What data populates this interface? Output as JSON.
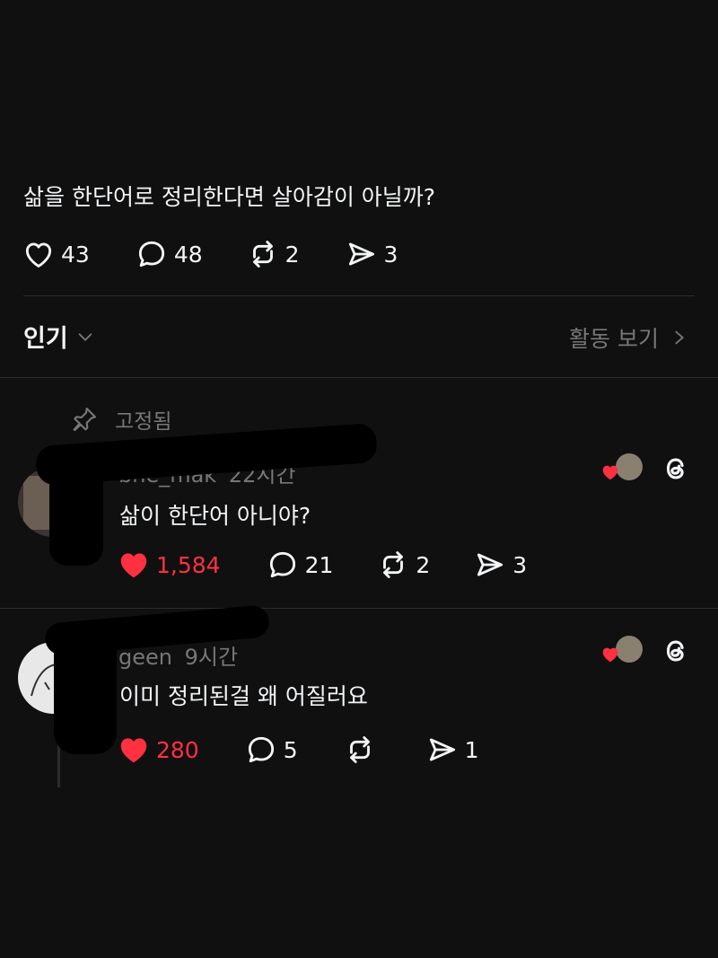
{
  "post": {
    "text": "삶을 한단어로 정리한다면 살아감이 아닐까?",
    "likes": "43",
    "replies": "48",
    "reposts": "2",
    "shares": "3"
  },
  "sort": {
    "label": "인기",
    "activity_label": "활동 보기"
  },
  "pinned_label": "고정됨",
  "comments": [
    {
      "username": "bhe_mak",
      "time": "22시간",
      "text": "삶이 한단어 아니야?",
      "likes": "1,584",
      "replies": "21",
      "reposts": "2",
      "shares": "3",
      "liked": true
    },
    {
      "username": "geen",
      "time": "9시간",
      "text": "이미 정리된걸 왜 어질러요",
      "likes": "280",
      "replies": "5",
      "reposts": "",
      "shares": "1",
      "liked": true
    }
  ],
  "colors": {
    "background": "#101010",
    "text": "#f3f5f7",
    "secondary": "#777777",
    "like": "#ff3040",
    "divider": "#2c2c2c"
  },
  "icons": [
    "heart-icon",
    "comment-icon",
    "repost-icon",
    "share-icon",
    "chevron-down-icon",
    "chevron-right-icon",
    "pin-icon",
    "threads-icon"
  ]
}
